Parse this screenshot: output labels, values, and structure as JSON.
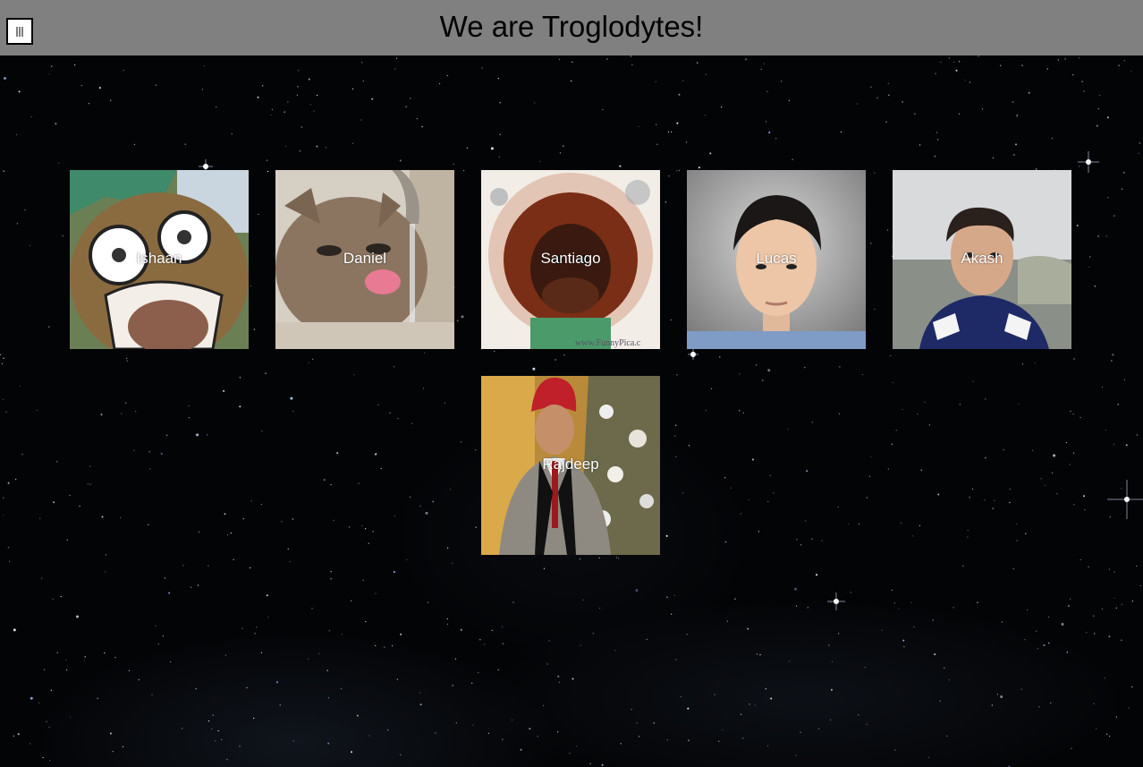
{
  "header": {
    "title": "We are Troglodytes!",
    "menu_icon": "hamburger-menu-icon",
    "background": "#808080"
  },
  "page": {
    "background": "starry-night-sky"
  },
  "members": [
    {
      "name": "Ishaan"
    },
    {
      "name": "Daniel"
    },
    {
      "name": "Santiago"
    },
    {
      "name": "Lucas"
    },
    {
      "name": "Akash"
    },
    {
      "name": "Rajdeep"
    }
  ]
}
